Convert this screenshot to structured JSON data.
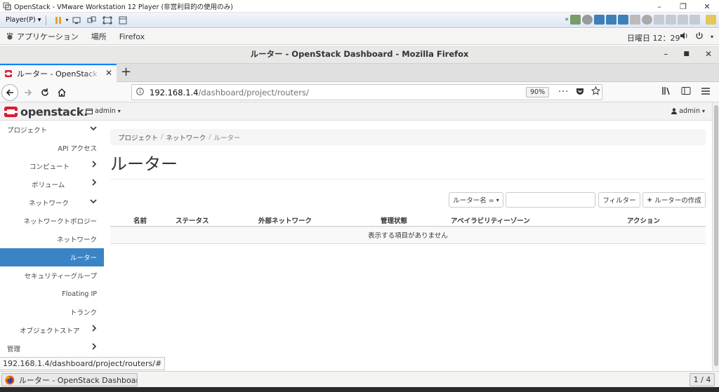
{
  "vmware": {
    "title": "OpenStack - VMware Workstation 12 Player (非営利目的の使用のみ)",
    "player_menu": "Player(P)"
  },
  "gnome": {
    "applications": "アプリケーション",
    "places": "場所",
    "firefox": "Firefox",
    "clock": "日曜日 12：29"
  },
  "firefox": {
    "window_title": "ルーター - OpenStack Dashboard - Mozilla Firefox",
    "tab_title": "ルーター - OpenStack Dashboard",
    "url_host": "192.168.1.4",
    "url_path": "/dashboard/project/routers/",
    "zoom": "90%",
    "status_link": "192.168.1.4/dashboard/project/routers/#"
  },
  "openstack": {
    "logo": "openstack.",
    "project": "admin",
    "user": "admin"
  },
  "sidebar": {
    "items": [
      {
        "label": "プロジェクト"
      },
      {
        "label": "API アクセス"
      },
      {
        "label": "コンピュート"
      },
      {
        "label": "ボリューム"
      },
      {
        "label": "ネットワーク"
      },
      {
        "label": "ネットワークトポロジー"
      },
      {
        "label": "ネットワーク"
      },
      {
        "label": "ルーター"
      },
      {
        "label": "セキュリティーグループ"
      },
      {
        "label": "Floating IP"
      },
      {
        "label": "トランク"
      },
      {
        "label": "オブジェクトストア"
      },
      {
        "label": "管理"
      }
    ]
  },
  "breadcrumb": [
    "プロジェクト",
    "ネットワーク",
    "ルーター"
  ],
  "page_title": "ルーター",
  "filter": {
    "select_label": "ルーター名 =",
    "button_label": "フィルター"
  },
  "create_button": "ルーターの作成",
  "table": {
    "headers": [
      "名前",
      "ステータス",
      "外部ネットワーク",
      "管理状態",
      "アベイラビリティーゾーン",
      "アクション"
    ],
    "empty_message": "表示する項目がありません"
  },
  "taskbar": {
    "item": "ルーター - OpenStack Dashboard",
    "workspace": "1 / 4"
  },
  "colors": {
    "active_nav": "#3a84c6",
    "firefox_accent": "#0a84ff",
    "openstack_red": "#da1a32"
  }
}
